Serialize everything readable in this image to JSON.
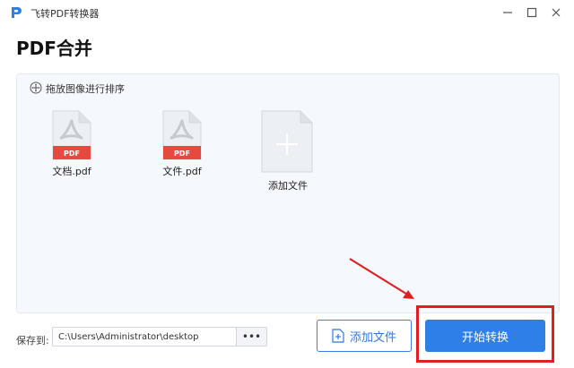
{
  "window": {
    "title": "飞转PDF转换器",
    "logo_icon": "pdf-p-logo-icon",
    "minimize_icon": "minimize-icon",
    "maximize_icon": "maximize-icon",
    "close_icon": "close-icon"
  },
  "page": {
    "title": "PDF合并"
  },
  "panel": {
    "hint_icon": "drag-move-icon",
    "hint": "拖放图像进行排序",
    "files": [
      {
        "badge": "PDF",
        "name": "文档.pdf",
        "icon": "pdf-file-icon"
      },
      {
        "badge": "PDF",
        "name": "文件.pdf",
        "icon": "pdf-file-icon"
      }
    ],
    "add_tile_label": "添加文件",
    "add_tile_icon": "plus-icon"
  },
  "footer": {
    "save_label": "保存到:",
    "save_path": "C:\\Users\\Administrator\\desktop",
    "browse_label": "•••",
    "add_file_label": "添加文件",
    "add_file_icon": "file-add-icon",
    "start_label": "开始转换"
  },
  "colors": {
    "accent": "#2f7fe8",
    "pdf_badge": "#e64a3f",
    "annotation": "#e02020"
  }
}
